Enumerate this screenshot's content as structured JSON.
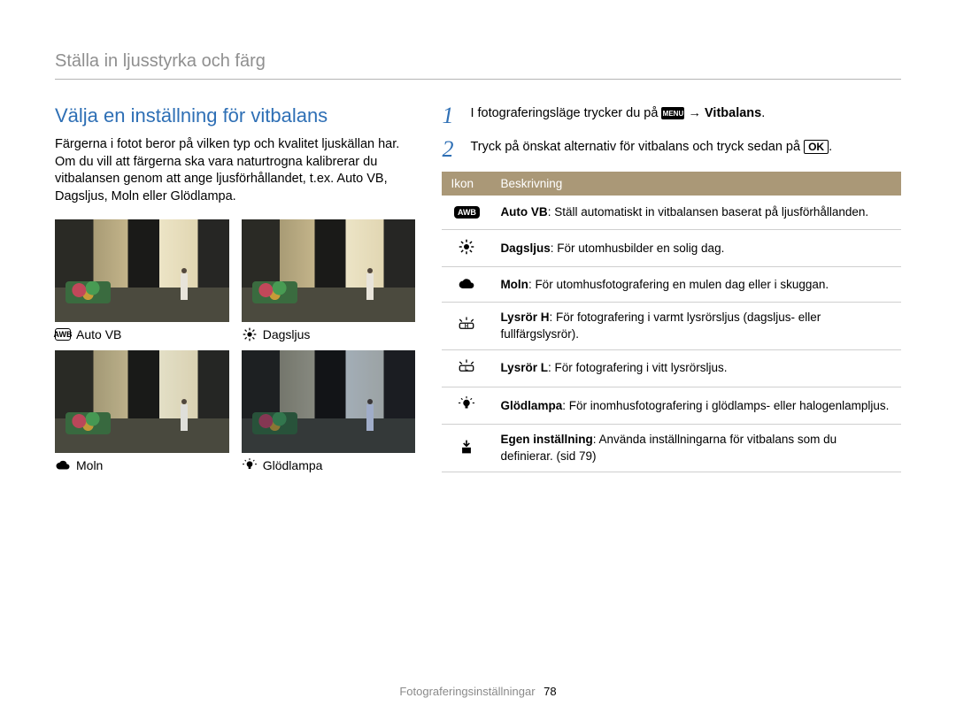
{
  "header": {
    "breadcrumb": "Ställa in ljusstyrka och färg"
  },
  "section": {
    "title": "Välja en inställning för vitbalans",
    "intro": "Färgerna i fotot beror på vilken typ och kvalitet ljuskällan har. Om du vill att färgerna ska vara naturtrogna kalibrerar du vitbalansen genom att ange ljusförhållandet, t.ex. Auto VB, Dagsljus, Moln eller Glödlampa."
  },
  "thumbnails": {
    "auto": {
      "label": "Auto VB",
      "icon_text": "AWB"
    },
    "day": {
      "label": "Dagsljus"
    },
    "cloud": {
      "label": "Moln"
    },
    "bulb": {
      "label": "Glödlampa"
    }
  },
  "steps": {
    "one": {
      "num": "1",
      "prefix": "I fotograferingsläge trycker du på ",
      "menu_badge": "MENU",
      "arrow": " → ",
      "target": "Vitbalans",
      "suffix": "."
    },
    "two": {
      "num": "2",
      "prefix": "Tryck på önskat alternativ för vitbalans och tryck sedan på ",
      "ok": "OK",
      "suffix": "."
    }
  },
  "table": {
    "head": {
      "icon": "Ikon",
      "desc": "Beskrivning"
    },
    "rows": {
      "auto": {
        "name": "Auto VB",
        "desc": ": Ställ automatiskt in vitbalansen baserat på ljusförhållanden.",
        "badge": "AWB"
      },
      "day": {
        "name": "Dagsljus",
        "desc": ": För utomhusbilder en solig dag."
      },
      "cloud": {
        "name": "Moln",
        "desc": ": För utomhusfotografering en mulen dag eller i skuggan."
      },
      "fluH": {
        "name": "Lysrör H",
        "desc": ": För fotografering i varmt lysrörsljus (dagsljus- eller fullfärgslysrör).",
        "badge": "H"
      },
      "fluL": {
        "name": "Lysrör L",
        "desc": ": För fotografering i vitt lysrörsljus.",
        "badge": "L"
      },
      "bulb": {
        "name": "Glödlampa",
        "desc": ": För inomhusfotografering i glödlamps- eller halogenlampljus."
      },
      "custom": {
        "name": "Egen inställning",
        "desc": ": Använda inställningarna för vitbalans som du definierar. (sid 79)"
      }
    }
  },
  "footer": {
    "section": "Fotograferingsinställningar",
    "page": "78"
  }
}
